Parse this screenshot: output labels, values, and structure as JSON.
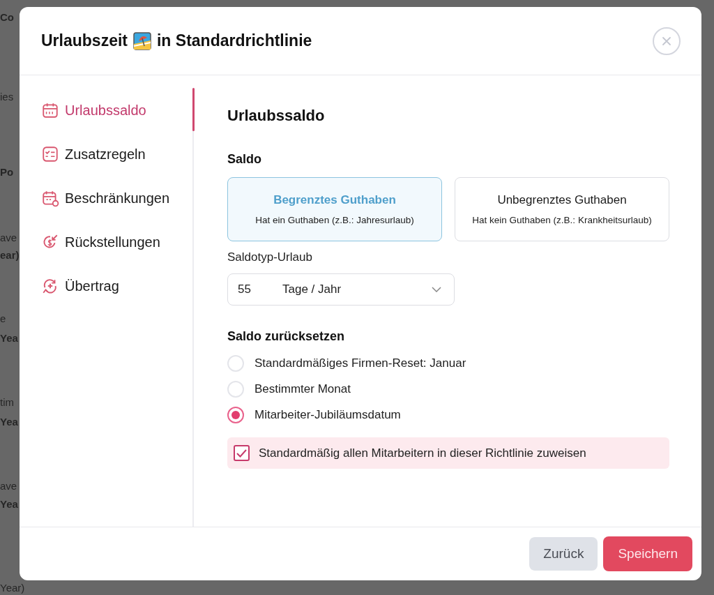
{
  "background": {
    "fragments": [
      "Co",
      "ies",
      "Po",
      "ave",
      "ear)",
      "e",
      "Yea",
      "tim",
      "Yea",
      "ave",
      "Yea",
      "Year)"
    ]
  },
  "dialog": {
    "title_start": "Urlaubszeit",
    "title_end": "in Standardrichtlinie"
  },
  "sidebar": {
    "items": [
      {
        "label": "Urlaubssaldo",
        "selected": true
      },
      {
        "label": "Zusatzregeln",
        "selected": false
      },
      {
        "label": "Beschränkungen",
        "selected": false
      },
      {
        "label": "Rückstellungen",
        "selected": false
      },
      {
        "label": "Übertrag",
        "selected": false
      }
    ]
  },
  "content": {
    "heading": "Urlaubssaldo",
    "saldo_label": "Saldo",
    "balance_options": [
      {
        "title": "Begrenztes Guthaben",
        "description": "Hat ein Guthaben (z.B.: Jahresurlaub)",
        "selected": true
      },
      {
        "title": "Unbegrenztes Guthaben",
        "description": "Hat kein Guthaben (z.B.: Krankheitsurlaub)",
        "selected": false
      }
    ],
    "type_label": "Saldotyp-Urlaub",
    "amount": "55",
    "unit": "Tage / Jahr",
    "reset_label": "Saldo zurücksetzen",
    "reset_options": [
      {
        "label": "Standardmäßiges Firmen-Reset: Januar",
        "selected": false
      },
      {
        "label": "Bestimmter Monat",
        "selected": false
      },
      {
        "label": "Mitarbeiter-Jubiläumsdatum",
        "selected": true
      }
    ],
    "assign": {
      "label": "Standardmäßig allen Mitarbeitern in dieser Richtlinie zuweisen",
      "checked": true
    }
  },
  "footer": {
    "buttons": [
      "Zurück",
      "Speichern"
    ]
  }
}
